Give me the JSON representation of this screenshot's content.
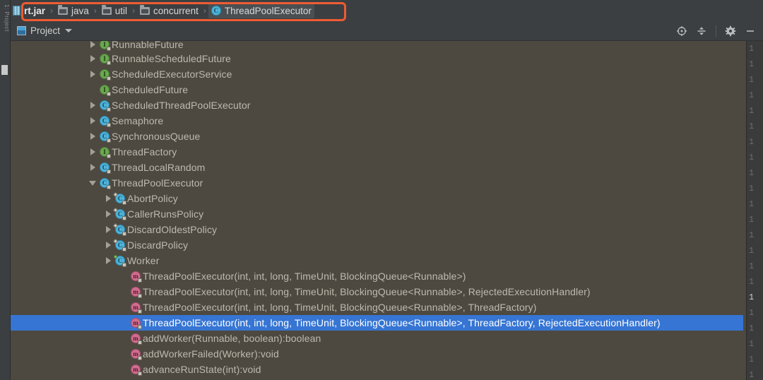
{
  "window": {
    "background_color": "#4d4941",
    "chrome_color": "#3c3f41",
    "selection_color": "#3675d3",
    "annotation_color": "#ef5b33"
  },
  "left_strip": {
    "vertical_label": "1: Project",
    "name": "tool-window-strip"
  },
  "breadcrumb": {
    "separator": "›",
    "items": [
      {
        "label": "rt.jar",
        "icon": "jar-icon",
        "active": false,
        "first": true
      },
      {
        "label": "java",
        "icon": "folder-icon",
        "active": false,
        "first": false
      },
      {
        "label": "util",
        "icon": "folder-icon",
        "active": false,
        "first": false
      },
      {
        "label": "concurrent",
        "icon": "folder-icon",
        "active": false,
        "first": false
      },
      {
        "label": "ThreadPoolExecutor",
        "icon": "class-icon",
        "active": true,
        "first": false
      }
    ]
  },
  "tool_window": {
    "title": "Project",
    "title_icon": "project-window-icon",
    "dropdown_icon": "chevron-down-icon",
    "actions": [
      {
        "name": "scroll-from-source-button",
        "icon": "target-icon"
      },
      {
        "name": "collapse-all-button",
        "icon": "collapse-all-icon"
      },
      {
        "name": "settings-button",
        "icon": "gear-icon"
      },
      {
        "name": "hide-button",
        "icon": "minimize-icon"
      }
    ]
  },
  "tree": {
    "rows": [
      {
        "label": "RunnableFuture",
        "icon": "interface-icon",
        "kind": "interface",
        "indent": 5,
        "arrow": "collapsed",
        "selected": false,
        "clipped_top": true
      },
      {
        "label": "RunnableScheduledFuture",
        "icon": "interface-icon",
        "kind": "interface",
        "indent": 5,
        "arrow": "collapsed",
        "selected": false
      },
      {
        "label": "ScheduledExecutorService",
        "icon": "interface-icon",
        "kind": "interface",
        "indent": 5,
        "arrow": "collapsed",
        "selected": false
      },
      {
        "label": "ScheduledFuture",
        "icon": "interface-icon",
        "kind": "interface",
        "indent": 5,
        "arrow": "none",
        "selected": false
      },
      {
        "label": "ScheduledThreadPoolExecutor",
        "icon": "class-icon",
        "kind": "class",
        "indent": 5,
        "arrow": "collapsed",
        "selected": false
      },
      {
        "label": "Semaphore",
        "icon": "class-icon",
        "kind": "class",
        "indent": 5,
        "arrow": "collapsed",
        "selected": false
      },
      {
        "label": "SynchronousQueue",
        "icon": "class-icon",
        "kind": "class",
        "indent": 5,
        "arrow": "collapsed",
        "selected": false
      },
      {
        "label": "ThreadFactory",
        "icon": "interface-icon",
        "kind": "interface",
        "indent": 5,
        "arrow": "collapsed",
        "selected": false
      },
      {
        "label": "ThreadLocalRandom",
        "icon": "class-icon",
        "kind": "class",
        "indent": 5,
        "arrow": "collapsed",
        "selected": false
      },
      {
        "label": "ThreadPoolExecutor",
        "icon": "class-icon",
        "kind": "class",
        "indent": 5,
        "arrow": "expanded",
        "selected": false
      },
      {
        "label": "AbortPolicy",
        "icon": "class-icon",
        "kind": "nested-class",
        "indent": 6,
        "arrow": "collapsed",
        "selected": false
      },
      {
        "label": "CallerRunsPolicy",
        "icon": "class-icon",
        "kind": "nested-class",
        "indent": 6,
        "arrow": "collapsed",
        "selected": false
      },
      {
        "label": "DiscardOldestPolicy",
        "icon": "class-icon",
        "kind": "nested-class",
        "indent": 6,
        "arrow": "collapsed",
        "selected": false
      },
      {
        "label": "DiscardPolicy",
        "icon": "class-icon",
        "kind": "nested-class",
        "indent": 6,
        "arrow": "collapsed",
        "selected": false
      },
      {
        "label": "Worker",
        "icon": "class-icon",
        "kind": "private-nested-class",
        "indent": 6,
        "arrow": "collapsed",
        "selected": false
      },
      {
        "label": "ThreadPoolExecutor(int, int, long, TimeUnit, BlockingQueue<Runnable>)",
        "icon": "method-icon",
        "kind": "method",
        "indent": 7,
        "arrow": "none",
        "selected": false
      },
      {
        "label": "ThreadPoolExecutor(int, int, long, TimeUnit, BlockingQueue<Runnable>, RejectedExecutionHandler)",
        "icon": "method-icon",
        "kind": "method",
        "indent": 7,
        "arrow": "none",
        "selected": false
      },
      {
        "label": "ThreadPoolExecutor(int, int, long, TimeUnit, BlockingQueue<Runnable>, ThreadFactory)",
        "icon": "method-icon",
        "kind": "method",
        "indent": 7,
        "arrow": "none",
        "selected": false
      },
      {
        "label": "ThreadPoolExecutor(int, int, long, TimeUnit, BlockingQueue<Runnable>, ThreadFactory, RejectedExecutionHandler)",
        "icon": "method-icon",
        "kind": "method",
        "indent": 7,
        "arrow": "none",
        "selected": true
      },
      {
        "label": "addWorker(Runnable, boolean):boolean",
        "icon": "method-icon",
        "kind": "method",
        "indent": 7,
        "arrow": "none",
        "selected": false
      },
      {
        "label": "addWorkerFailed(Worker):void",
        "icon": "method-icon",
        "kind": "method",
        "indent": 7,
        "arrow": "none",
        "selected": false
      },
      {
        "label": "advanceRunState(int):void",
        "icon": "method-icon",
        "kind": "method",
        "indent": 7,
        "arrow": "none",
        "selected": false
      }
    ]
  },
  "gutter": {
    "line_numbers": [
      "1",
      "1",
      "1",
      "1",
      "1",
      "1",
      "1",
      "1",
      "1",
      "1",
      "1",
      "1",
      "1",
      "1",
      "1",
      "1",
      "1",
      "1",
      "1",
      "1",
      "1",
      "1"
    ],
    "current_index": 16
  }
}
